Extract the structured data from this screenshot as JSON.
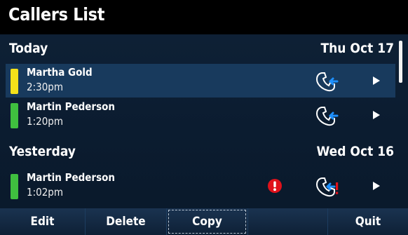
{
  "header": {
    "title": "Callers List"
  },
  "sections": [
    {
      "label": "Today",
      "date": "Thu Oct 17",
      "entries": [
        {
          "name": "Martha Gold",
          "time": "2:30pm",
          "status_color": "#f4e11a",
          "call_icon": "incoming-call-icon",
          "selected": true
        },
        {
          "name": "Martin Pederson",
          "time": "1:20pm",
          "status_color": "#3fbf3f",
          "call_icon": "incoming-call-icon",
          "selected": false
        }
      ]
    },
    {
      "label": "Yesterday",
      "date": "Wed Oct 16",
      "entries": [
        {
          "name": "Martin Pederson",
          "time": "1:02pm",
          "status_color": "#3fbf3f",
          "call_icon": "missed-incoming-call-icon",
          "alert_icon": "alert-icon",
          "selected": false
        }
      ]
    }
  ],
  "softkeys": [
    {
      "label": "Edit"
    },
    {
      "label": "Delete"
    },
    {
      "label": "Copy",
      "focused": true
    },
    {
      "label": ""
    },
    {
      "label": "Quit"
    }
  ],
  "colors": {
    "selected_row": "#183a5d",
    "arrow_blue": "#1e90ff",
    "alert_red": "#e0121b"
  }
}
